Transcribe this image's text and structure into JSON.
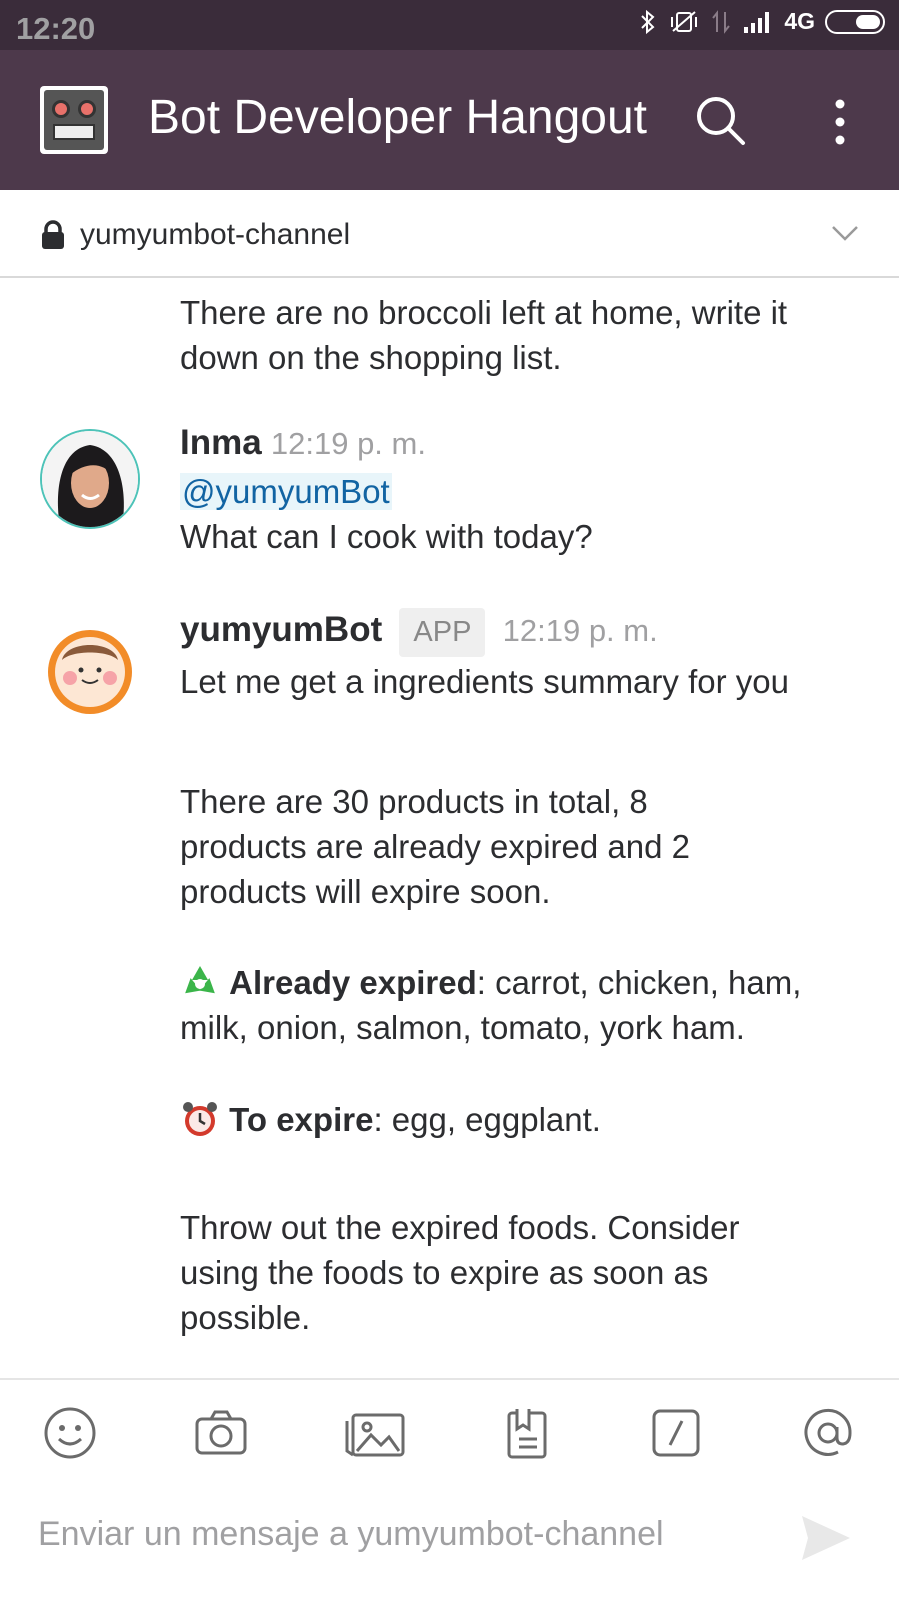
{
  "status_bar": {
    "time": "12:20",
    "network": "4G"
  },
  "app_bar": {
    "team_name": "Bot Developer Hangout"
  },
  "channel": {
    "name": "yumyumbot-channel"
  },
  "messages": {
    "continuation": {
      "text": "There are no broccoli left at home, write it down on the shopping list."
    },
    "inma": {
      "author": "Inma",
      "time": "12:19 p. m.",
      "mention": "@yumyumBot",
      "text": "What can I cook with today?"
    },
    "bot": {
      "author": "yumyumBot",
      "badge": "APP",
      "time": "12:19 p. m.",
      "intro": "Let me get a ingredients summary for you",
      "summary": "There are 30 products in total, 8 products are already expired and 2 products will expire soon.",
      "expired_label": "Already expired",
      "expired_items": ": carrot, chicken, ham, milk, onion, salmon, tomato, york ham.",
      "to_expire_label": "To expire",
      "to_expire_items": ": egg, eggplant.",
      "advice": "Throw out the expired foods. Consider using the foods to expire as soon as possible."
    }
  },
  "composer": {
    "placeholder": "Enviar un mensaje a yumyumbot-channel"
  },
  "icons": {
    "toolbar": [
      "emoji-icon",
      "camera-icon",
      "gallery-icon",
      "file-icon",
      "slash-command-icon",
      "mention-icon"
    ]
  },
  "colors": {
    "app_bar": "#4d394b",
    "status_bar": "#3a2c3a",
    "mention": "#1264a3"
  }
}
